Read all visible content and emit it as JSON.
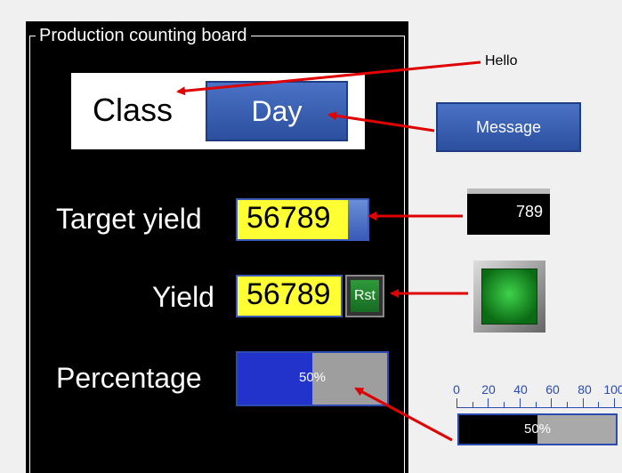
{
  "board": {
    "title": "Production counting board",
    "class_label": "Class",
    "class_value": "Day",
    "target_label": "Target yield",
    "target_value": "56789",
    "yield_label": "Yield",
    "yield_value": "56789",
    "reset_label": "Rst",
    "percentage_label": "Percentage",
    "percentage_text": "50%",
    "percentage_fraction": 0.5
  },
  "side": {
    "hello_text": "Hello",
    "message_button": "Message",
    "number_display": "789",
    "lamp_state": "green",
    "scale_labels": [
      "0",
      "20",
      "40",
      "60",
      "80",
      "100"
    ],
    "bar_text": "50%",
    "bar_fraction": 0.5
  },
  "colors": {
    "accent_blue": "#2c4f9e",
    "field_yellow": "#ffff33",
    "arrow_red": "#e00000",
    "lamp_green": "#1c9a2a"
  }
}
